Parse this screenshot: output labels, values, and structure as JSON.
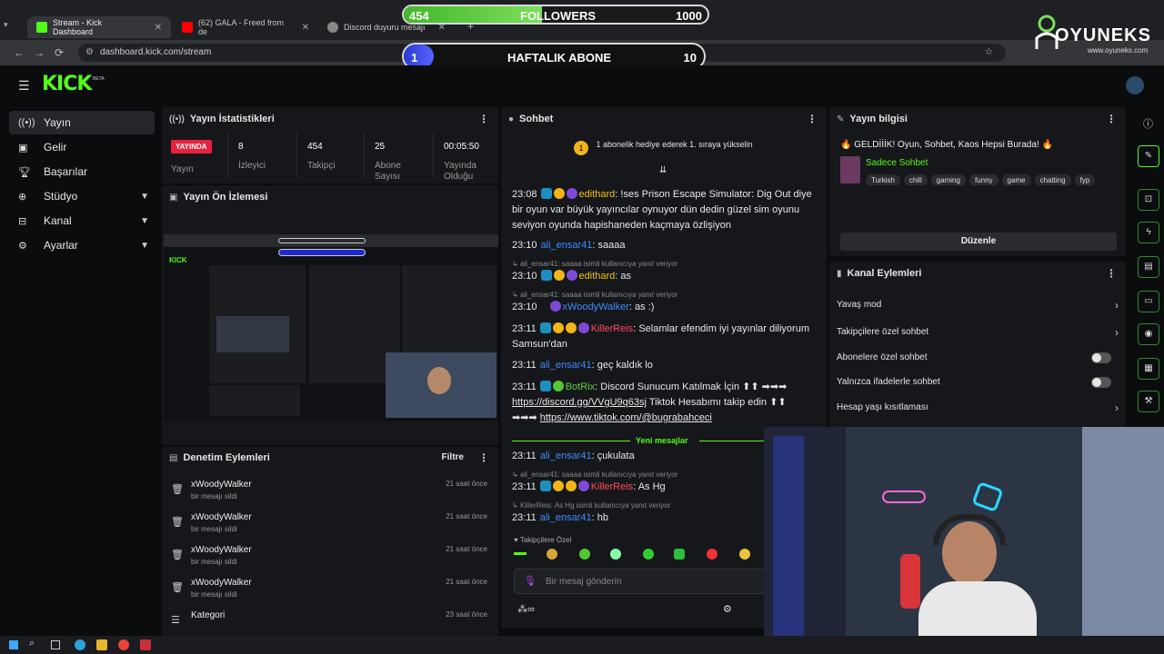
{
  "browser": {
    "tabs": [
      {
        "label": "Stream - Kick Dashboard",
        "active": true
      },
      {
        "label": "(62) GALA - Freed from de",
        "active": false
      },
      {
        "label": "Discord duyuru mesajı",
        "active": false
      }
    ],
    "url": "dashboard.kick.com/stream"
  },
  "overlay": {
    "followers": {
      "current": "454",
      "label": "FOLLOWERS",
      "goal": "1000",
      "progress": 0.454
    },
    "subs": {
      "current": "1",
      "label": "HAFTALIK ABONE",
      "goal": "10",
      "progress": 0.1
    },
    "brand": "OYUNEKS",
    "brand_url": "www.oyuneks.com"
  },
  "kick": {
    "logo": "KICK",
    "logo_sup": "BETA",
    "sidebar": [
      {
        "label": "Yayın",
        "icon": "broadcast-icon",
        "active": true
      },
      {
        "label": "Gelir",
        "icon": "revenue-icon"
      },
      {
        "label": "Başarılar",
        "icon": "trophy-icon"
      },
      {
        "label": "Stüdyo",
        "icon": "studio-icon",
        "expand": true
      },
      {
        "label": "Kanal",
        "icon": "channel-icon",
        "expand": true
      },
      {
        "label": "Ayarlar",
        "icon": "settings-icon",
        "expand": true
      }
    ]
  },
  "stats": {
    "title": "Yayın İstatistikleri",
    "live_badge": "YAYINDA",
    "items": [
      {
        "label": "Yayın",
        "value": ""
      },
      {
        "label": "İzleyici",
        "value": "8"
      },
      {
        "label": "Takipçi",
        "value": "454"
      },
      {
        "label": "Abone Sayısı",
        "value": "25"
      },
      {
        "label": "Yayında Olduğu",
        "value": "00:05:50"
      }
    ]
  },
  "preview": {
    "title": "Yayın Ön İzlemesi"
  },
  "moderation": {
    "title": "Denetim Eylemleri",
    "filter": "Filtre",
    "rows": [
      {
        "user": "xWoodyWalker",
        "desc": "bir mesajı sildi",
        "time": "21 saat önce"
      },
      {
        "user": "xWoodyWalker",
        "desc": "bir mesajı sildi",
        "time": "21 saat önce"
      },
      {
        "user": "xWoodyWalker",
        "desc": "bir mesajı sildi",
        "time": "21 saat önce"
      },
      {
        "user": "xWoodyWalker",
        "desc": "bir mesajı sildi",
        "time": "21 saat önce"
      },
      {
        "user": "Kategori",
        "desc": "",
        "time": "23 saat önce"
      }
    ]
  },
  "chat": {
    "title": "Sohbet",
    "pinned": "1 abonelik hediye ederek 1. sıraya yükselin",
    "new_messages": "Yeni mesajlar",
    "followers_only": "Takipçilere Özel",
    "placeholder": "Bir mesaj gönderin",
    "messages": [
      {
        "time": "23:08",
        "user": "edithard",
        "text": "!ses Prison Escape Simulator: Dig Out diye bir oyun var büyük yayıncılar oynuyor dün dedin güzel sim oyunu seviyon oyunda hapishaneden kaçmaya özlişiyon"
      },
      {
        "time": "23:10",
        "user": "ali_ensar41",
        "text": "saaaa"
      },
      {
        "reply": "ali_ensar41: saaaa isimli kullanıcıya yanıt veriyor"
      },
      {
        "time": "23:10",
        "user": "edithard",
        "text": "as"
      },
      {
        "reply": "ali_ensar41: saaaa isimli kullanıcıya yanıt veriyor"
      },
      {
        "time": "23:10",
        "user": "xWoodyWalker",
        "text": "as :)"
      },
      {
        "time": "23:11",
        "user": "KillerReis",
        "text": "Selamlar efendim iyi yayınlar diliyorum Samsun'dan"
      },
      {
        "time": "23:11",
        "user": "ali_ensar41",
        "text": "geç kaldık lo"
      },
      {
        "time": "23:11",
        "user": "BotRix",
        "text": "Discord Sunucum Katılmak İçin ⬆⬆ ➡➡➡",
        "link1": "https://discord.gg/VVgU9q63sj",
        "mid": "Tiktok Hesabımı takip edin ⬆⬆ ➡➡➡",
        "link2": "https://www.tiktok.com/@bugrabahceci"
      },
      {
        "time": "23:11",
        "user": "ali_ensar41",
        "text": "çukulata"
      },
      {
        "reply": "ali_ensar41: saaaa isimli kullanıcıya yanıt veriyor"
      },
      {
        "time": "23:11",
        "user": "KillerReis",
        "text": "As Hg"
      },
      {
        "reply": "KillerReis: As Hg isimli kullanıcıya yanıt veriyor"
      },
      {
        "time": "23:11",
        "user": "ali_ensar41",
        "text": "hb"
      }
    ]
  },
  "info": {
    "title": "Yayın bilgisi",
    "stream_title": "🔥 GELDİİİK! Oyun, Sohbet, Kaos Hepsi Burada! 🔥",
    "category": "Sadece Sohbet",
    "tags": [
      "Turkish",
      "chill",
      "gaming",
      "funny",
      "game",
      "chatting",
      "fyp"
    ],
    "edit": "Düzenle"
  },
  "channel_actions": {
    "title": "Kanal Eylemleri",
    "rows": [
      {
        "label": "Yavaş mod",
        "type": "arrow"
      },
      {
        "label": "Takipçilere özel sohbet",
        "type": "arrow"
      },
      {
        "label": "Abonelere özel sohbet",
        "type": "toggle"
      },
      {
        "label": "Yalnızca ifadelerle sohbet",
        "type": "toggle"
      },
      {
        "label": "Hesap yaşı kısıtlaması",
        "type": "arrow"
      }
    ]
  },
  "colors": {
    "kick_green": "#53fc18",
    "live_red": "#e8213f"
  }
}
